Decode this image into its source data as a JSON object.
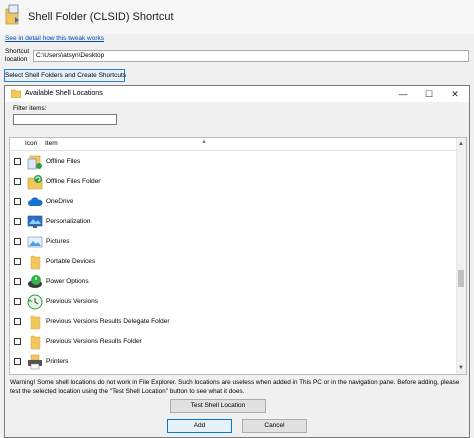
{
  "app": {
    "title": "Shell Folder (CLSID) Shortcut",
    "link_text": "See in detail how this tweak works",
    "shortcut_location_label": "Shortcut location",
    "shortcut_location_value": "C:\\Users\\atsyn\\Desktop",
    "select_button_label": "Select Shell Folders and Create Shortcuts"
  },
  "dialog": {
    "title": "Available Shell Locations",
    "filter_label": "Filter items:",
    "filter_value": "",
    "columns": {
      "icon": "Icon",
      "item": "Item"
    },
    "items": [
      {
        "label": "Offline Files",
        "icon": "offline-files-icon",
        "checked": false
      },
      {
        "label": "Offline Files Folder",
        "icon": "offline-files-folder-icon",
        "checked": false
      },
      {
        "label": "OneDrive",
        "icon": "onedrive-cloud-icon",
        "checked": false
      },
      {
        "label": "Personalization",
        "icon": "personalization-monitor-icon",
        "checked": false
      },
      {
        "label": "Pictures",
        "icon": "pictures-icon",
        "checked": false
      },
      {
        "label": "Portable Devices",
        "icon": "folder-icon",
        "checked": false
      },
      {
        "label": "Power Options",
        "icon": "power-options-icon",
        "checked": false
      },
      {
        "label": "Previous Versions",
        "icon": "previous-versions-icon",
        "checked": false
      },
      {
        "label": "Previous Versions Results Delegate Folder",
        "icon": "folder-icon",
        "checked": false
      },
      {
        "label": "Previous Versions Results Folder",
        "icon": "folder-icon",
        "checked": false
      },
      {
        "label": "Printers",
        "icon": "printers-icon",
        "checked": false
      }
    ],
    "warning": "Warning! Some shell locations do not work in File Explorer. Such locations are useless when added in This PC or in the navigation pane. Before adding, please test the selected location using the \"Test Shell Location\" button to see what it does.",
    "test_button_label": "Test Shell Location",
    "add_button_label": "Add",
    "cancel_button_label": "Cancel"
  },
  "colors": {
    "accent": "#0078d7",
    "folder": "#f4c55c",
    "link": "#0645ad"
  }
}
